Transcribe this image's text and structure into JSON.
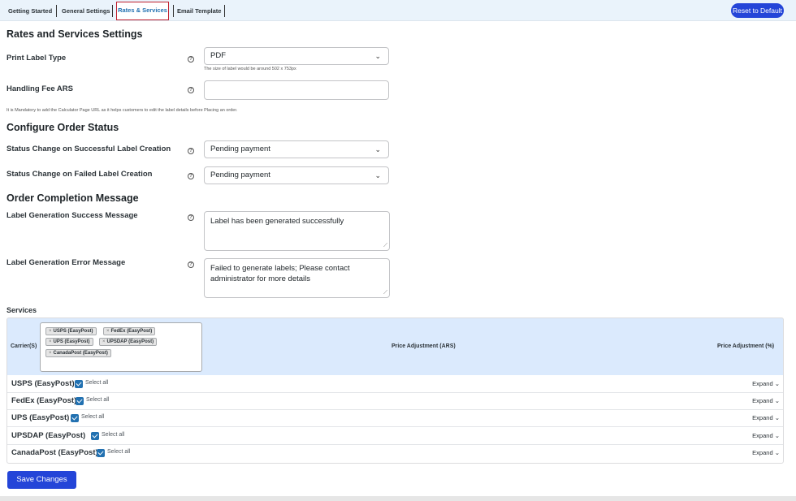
{
  "tabs": [
    {
      "label": "Getting Started"
    },
    {
      "label": "General Settings"
    },
    {
      "label": "Rates & Services"
    },
    {
      "label": "Email Template"
    }
  ],
  "reset_label": "Reset to Default",
  "rates_heading": "Rates and Services Settings",
  "print_label": {
    "label": "Print Label Type",
    "value": "PDF",
    "note": "The size of label would be around 502 x 753px"
  },
  "handling_fee": {
    "label": "Handling Fee ARS",
    "value": ""
  },
  "mandatory_note": "It is Mandatory to add the Calculator Page URL as it helps customers to edit the label details before Placing an order.",
  "order_status_heading": "Configure Order Status",
  "status_success": {
    "label": "Status Change on Successful Label Creation",
    "value": "Pending payment"
  },
  "status_failed": {
    "label": "Status Change on Failed Label Creation",
    "value": "Pending payment"
  },
  "completion_heading": "Order Completion Message",
  "success_message": {
    "label": "Label Generation Success Message",
    "value": "Label has been generated successfully"
  },
  "error_message": {
    "label": "Label Generation Error Message",
    "value": "Failed to generate labels; Please contact administrator for more details"
  },
  "services": {
    "label": "Services",
    "col_carrier": "Carrier(S)",
    "col_price_ars": "Price Adjustment (ARS)",
    "col_price_pct": "Price Adjustment (%)",
    "chips": [
      "USPS (EasyPost)",
      "FedEx (EasyPost)",
      "UPS (EasyPost)",
      "UPSDAP (EasyPost)",
      "CanadaPost (EasyPost)"
    ],
    "rows": [
      {
        "name": "USPS (EasyPost)",
        "select_all": "Select all",
        "expand": "Expand"
      },
      {
        "name": "FedEx (EasyPost)",
        "select_all": "Select all",
        "expand": "Expand"
      },
      {
        "name": "UPS (EasyPost)",
        "select_all": "Select all",
        "expand": "Expand"
      },
      {
        "name": "UPSDAP (EasyPost)",
        "select_all": "Select all",
        "expand": "Expand"
      },
      {
        "name": "CanadaPost (EasyPost)",
        "select_all": "Select all",
        "expand": "Expand"
      }
    ]
  },
  "save_label": "Save Changes",
  "colors": {
    "accent": "#2445d8",
    "tab_highlight": "#c0202f",
    "header_bg": "#dbeafd"
  }
}
